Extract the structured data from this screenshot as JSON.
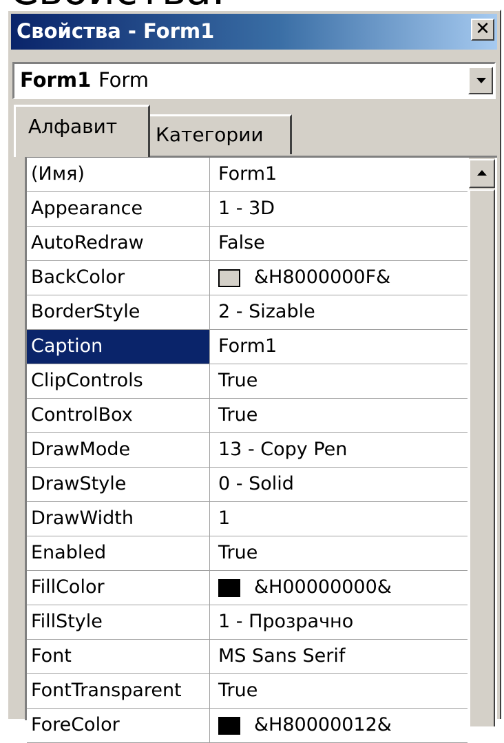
{
  "slide": {
    "heading": "Свойства:"
  },
  "window": {
    "title": "Свойства - Form1",
    "close_glyph": "✕"
  },
  "object_selector": {
    "name": "Form1",
    "type": "Form"
  },
  "tabs": [
    {
      "label": "Алфавит",
      "active": true
    },
    {
      "label": "Категории",
      "active": false
    }
  ],
  "properties": [
    {
      "name": "(Имя)",
      "value": "Form1"
    },
    {
      "name": "Appearance",
      "value": "1 - 3D"
    },
    {
      "name": "AutoRedraw",
      "value": "False"
    },
    {
      "name": "BackColor",
      "value": "&H8000000F&",
      "swatch": "#d4d0c8"
    },
    {
      "name": "BorderStyle",
      "value": "2 - Sizable"
    },
    {
      "name": "Caption",
      "value": "Form1",
      "selected": true
    },
    {
      "name": "ClipControls",
      "value": "True"
    },
    {
      "name": "ControlBox",
      "value": "True"
    },
    {
      "name": "DrawMode",
      "value": "13 - Copy Pen"
    },
    {
      "name": "DrawStyle",
      "value": "0 - Solid"
    },
    {
      "name": "DrawWidth",
      "value": "1"
    },
    {
      "name": "Enabled",
      "value": "True"
    },
    {
      "name": "FillColor",
      "value": "&H00000000&",
      "swatch": "#000000"
    },
    {
      "name": "FillStyle",
      "value": "1 - Прозрачно"
    },
    {
      "name": "Font",
      "value": "MS Sans Serif"
    },
    {
      "name": "FontTransparent",
      "value": "True"
    },
    {
      "name": "ForeColor",
      "value": "&H80000012&",
      "swatch": "#000000"
    }
  ],
  "colors": {
    "titlebar_start": "#0a246a",
    "titlebar_end": "#a6caf0",
    "selection": "#0a246a",
    "face": "#d4d0c8"
  }
}
